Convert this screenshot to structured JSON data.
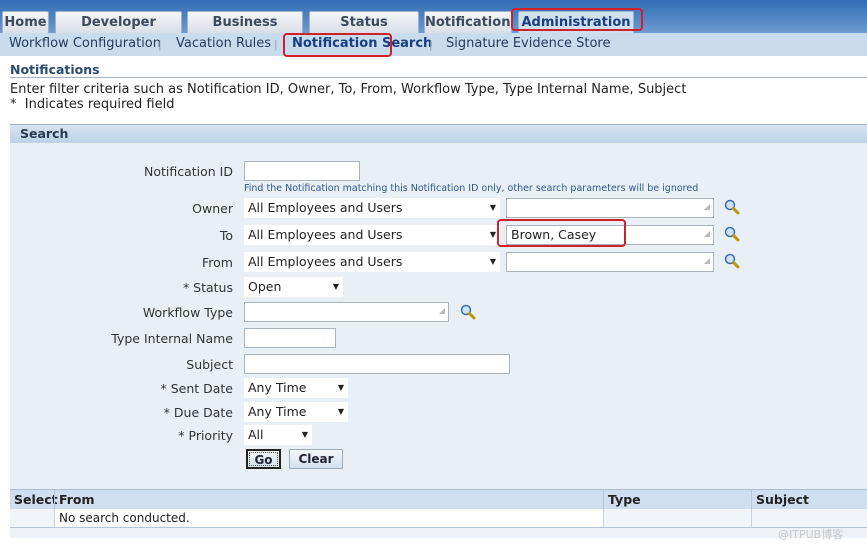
{
  "tabs": [
    {
      "label": "Home"
    },
    {
      "label": "Developer Studio"
    },
    {
      "label": "Business Events"
    },
    {
      "label": "Status Monitor"
    },
    {
      "label": "Notifications"
    },
    {
      "label": "Administration"
    }
  ],
  "subnav": [
    {
      "label": "Workflow Configuration"
    },
    {
      "label": "Vacation Rules"
    },
    {
      "label": "Notification Search"
    },
    {
      "label": "Signature Evidence Store"
    }
  ],
  "page": {
    "title": "Notifications",
    "instructions": "Enter filter criteria such as Notification ID, Owner, To, From, Workflow Type, Type Internal Name, Subject",
    "required_note": "*  Indicates required field",
    "section": "Search"
  },
  "form": {
    "notification_id": {
      "label": "Notification ID",
      "value": "",
      "hint": "Find the Notification matching this Notification ID only, other search parameters will be ignored"
    },
    "owner": {
      "label": "Owner",
      "select": "All Employees and Users",
      "value": ""
    },
    "to": {
      "label": "To",
      "select": "All Employees and Users",
      "value": "Brown, Casey"
    },
    "from": {
      "label": "From",
      "select": "All Employees and Users",
      "value": ""
    },
    "status": {
      "label": "* Status",
      "value": "Open"
    },
    "workflow_type": {
      "label": "Workflow Type",
      "value": ""
    },
    "type_internal_name": {
      "label": "Type Internal Name",
      "value": ""
    },
    "subject": {
      "label": "Subject",
      "value": ""
    },
    "sent_date": {
      "label": "* Sent Date",
      "value": "Any Time"
    },
    "due_date": {
      "label": "* Due Date",
      "value": "Any Time"
    },
    "priority": {
      "label": "* Priority",
      "value": "All"
    },
    "go": "Go",
    "clear": "Clear"
  },
  "table": {
    "columns": [
      "Select",
      "From",
      "Type",
      "Subject"
    ],
    "empty": "No search conducted."
  },
  "watermark": "@ITPUB博客"
}
